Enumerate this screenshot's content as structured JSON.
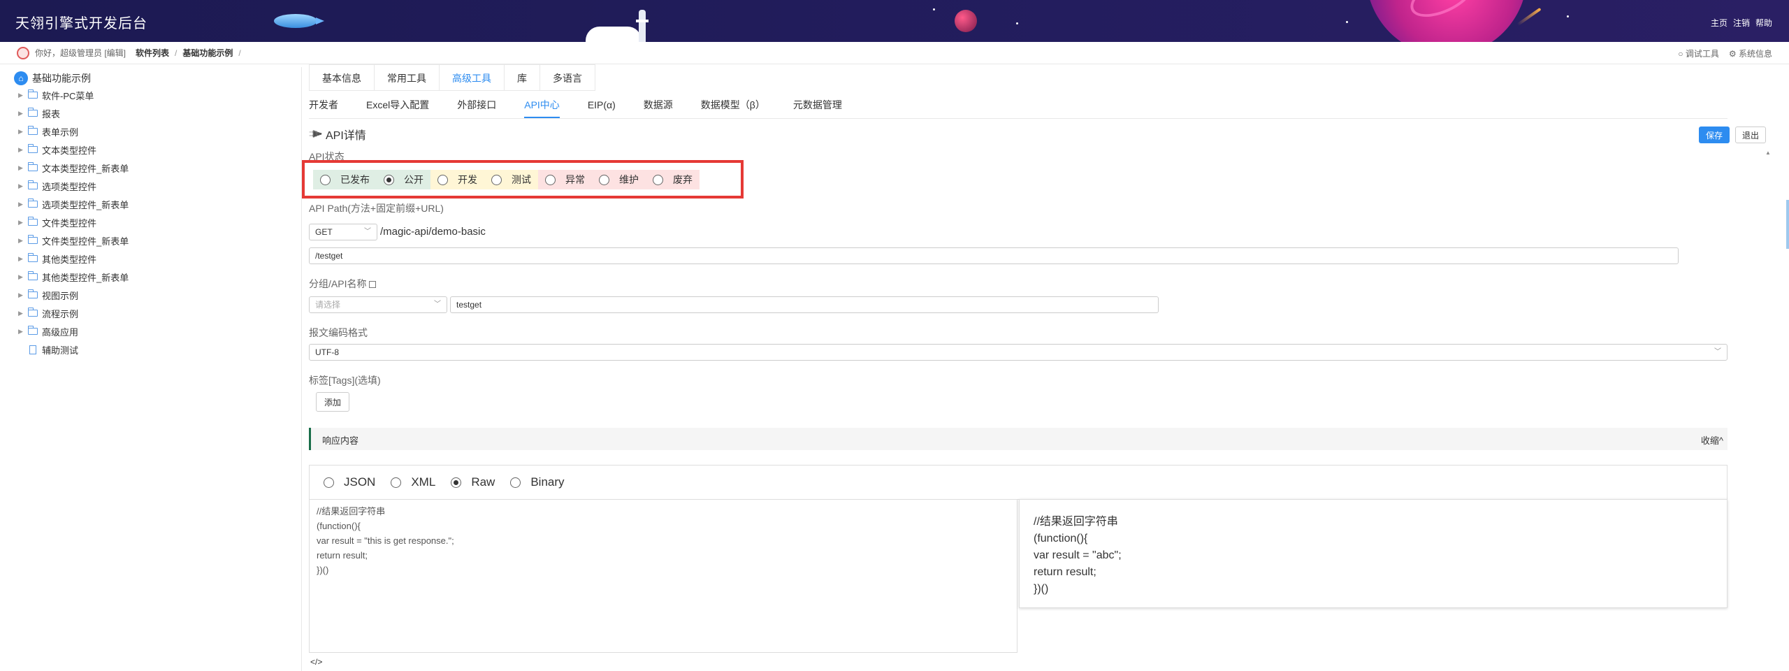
{
  "header": {
    "title": "天翎引擎式开发后台",
    "links": [
      "主页",
      "注销",
      "帮助"
    ]
  },
  "breadcrumb": {
    "greeting": "你好，超级管理员 [编辑]",
    "items": [
      "软件列表",
      "基础功能示例"
    ],
    "sep": "/",
    "tools": [
      "调试工具",
      "系统信息"
    ]
  },
  "sidebar": {
    "root": "基础功能示例",
    "items": [
      "软件-PC菜单",
      "报表",
      "表单示例",
      "文本类型控件",
      "文本类型控件_新表单",
      "选项类型控件",
      "选项类型控件_新表单",
      "文件类型控件",
      "文件类型控件_新表单",
      "其他类型控件",
      "其他类型控件_新表单",
      "视图示例",
      "流程示例",
      "高级应用"
    ],
    "leaf": "辅助测试"
  },
  "tabs_top": [
    {
      "label": "基本信息",
      "active": false
    },
    {
      "label": "常用工具",
      "active": false
    },
    {
      "label": "高级工具",
      "active": true
    },
    {
      "label": "库",
      "active": false
    },
    {
      "label": "多语言",
      "active": false
    }
  ],
  "tabs_sub": [
    {
      "label": "开发者",
      "active": false
    },
    {
      "label": "Excel导入配置",
      "active": false
    },
    {
      "label": "外部接口",
      "active": false
    },
    {
      "label": "API中心",
      "active": true
    },
    {
      "label": "EIP(α)",
      "active": false
    },
    {
      "label": "数据源",
      "active": false
    },
    {
      "label": "数据模型（β）",
      "active": false
    },
    {
      "label": "元数据管理",
      "active": false
    }
  ],
  "api": {
    "title": "API详情",
    "save": "保存",
    "exit": "退出",
    "status_label": "API状态",
    "statuses": [
      {
        "label": "已发布",
        "checked": false,
        "bg": "#dfeee4"
      },
      {
        "label": "公开",
        "checked": true,
        "bg": "#dfeee4"
      },
      {
        "label": "开发",
        "checked": false,
        "bg": "#fff6d6"
      },
      {
        "label": "测试",
        "checked": false,
        "bg": "#fff6d6"
      },
      {
        "label": "异常",
        "checked": false,
        "bg": "#fde2e2"
      },
      {
        "label": "维护",
        "checked": false,
        "bg": "#fde2e2"
      },
      {
        "label": "废弃",
        "checked": false,
        "bg": "#fde2e2"
      }
    ],
    "path_label": "API Path(方法+固定前缀+URL)",
    "method": "GET",
    "prefix": "/magic-api/demo-basic",
    "url": "/testget",
    "group_label": "分组/API名称",
    "group_placeholder": "请选择",
    "name_value": "testget",
    "encoding_label": "报文编码格式",
    "encoding": "UTF-8",
    "tags_label": "标签[Tags](选填)",
    "add": "添加"
  },
  "response": {
    "title": "响应内容",
    "collapse": "收缩^",
    "formats": [
      {
        "label": "JSON",
        "checked": false
      },
      {
        "label": "XML",
        "checked": false
      },
      {
        "label": "Raw",
        "checked": true
      },
      {
        "label": "Binary",
        "checked": false
      }
    ],
    "code_left": "//结果返回字符串\n(function(){\nvar result = \"this is get response.\";\nreturn result;\n})()",
    "code_right": "//结果返回字符串\n(function(){\nvar result = \"abc\";\nreturn result;\n})()",
    "code_icon": "</>"
  }
}
